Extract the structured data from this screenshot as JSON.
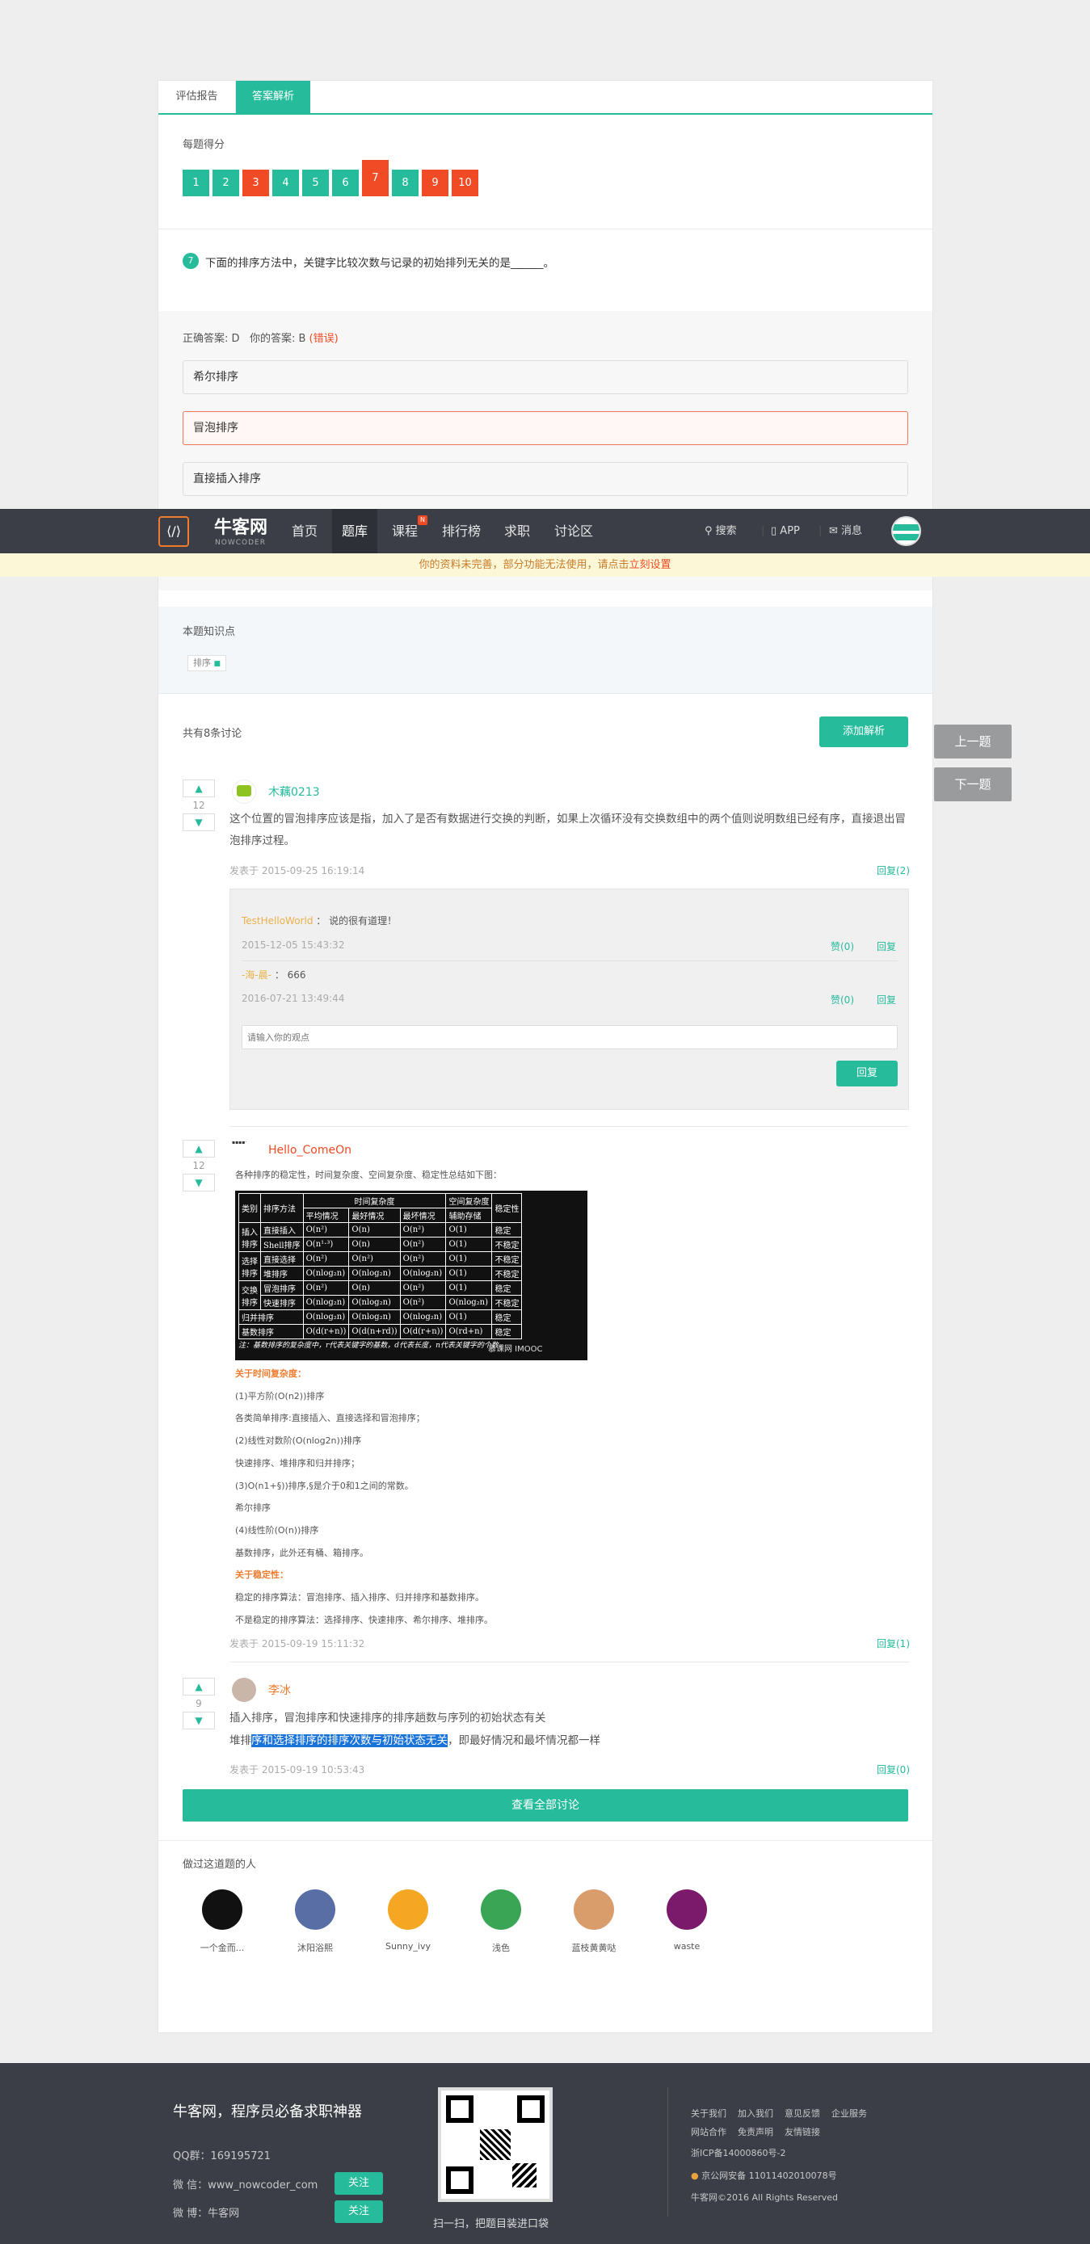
{
  "tabs": [
    "评估报告",
    "答案解析"
  ],
  "score_label": "每题得分",
  "questions": [
    {
      "n": "1",
      "status": "correct"
    },
    {
      "n": "2",
      "status": "correct"
    },
    {
      "n": "3",
      "status": "wrong"
    },
    {
      "n": "4",
      "status": "correct"
    },
    {
      "n": "5",
      "status": "correct"
    },
    {
      "n": "6",
      "status": "correct"
    },
    {
      "n": "7",
      "status": "wrong"
    },
    {
      "n": "8",
      "status": "correct"
    },
    {
      "n": "9",
      "status": "wrong"
    },
    {
      "n": "10",
      "status": "wrong"
    }
  ],
  "question": {
    "num": "7",
    "text": "下面的排序方法中，关键字比较次数与记录的初始排列无关的是______。"
  },
  "answer": {
    "correct_label": "正确答案: D",
    "yours_label": "你的答案: B",
    "verdict": "(错误)"
  },
  "options": [
    "希尔排序",
    "冒泡排序",
    "直接插入排序"
  ],
  "nav": {
    "logo": "牛客网",
    "logo_sub": "NOWCODER",
    "items": [
      "首页",
      "题库",
      "课程",
      "排行榜",
      "求职",
      "讨论区"
    ],
    "badge": "N",
    "search": "搜索",
    "app": "APP",
    "messages": "消息"
  },
  "notice": {
    "text": "你的资料未完善，部分功能无法使用，请点击",
    "link": "立刻设置"
  },
  "knowledge": {
    "title": "本题知识点",
    "tag": "排序"
  },
  "discussion": {
    "count": "共有8条讨论",
    "add_btn": "添加解析"
  },
  "side": {
    "prev": "上一题",
    "next": "下一题"
  },
  "posts": [
    {
      "votes": "12",
      "user": "木藕0213",
      "text": "这个位置的冒泡排序应该是指，加入了是否有数据进行交换的判断，如果上次循环没有交换数组中的两个值则说明数组已经有序，直接退出冒泡排序过程。",
      "time": "发表于 2015-09-25 16:19:14",
      "reply": "回复(2)",
      "comments": [
        {
          "user": "TestHelloWorld",
          "text": "：  说的很有道理！",
          "time": "2015-12-05 15:43:32",
          "like": "赞(0)",
          "reply": "回复"
        },
        {
          "user": "-海-晨-",
          "text": "：  666",
          "time": "2016-07-21 13:49:44",
          "like": "赞(0)",
          "reply": "回复"
        }
      ],
      "input_placeholder": "请输入你的观点",
      "reply_btn": "回复"
    },
    {
      "votes": "12",
      "user": "Hello_ComeOn",
      "intro": "各种排序的稳定性，时间复杂度、空间复杂度、稳定性总结如下图：",
      "lines": [
        {
          "text": "关于时间复杂度：",
          "hl": true
        },
        {
          "text": "(1)平方阶(O(n2))排序",
          "hl": false
        },
        {
          "text": "各类简单排序:直接插入、直接选择和冒泡排序；",
          "hl": false
        },
        {
          "text": "(2)线性对数阶(O(nlog2n))排序",
          "hl": false
        },
        {
          "text": "快速排序、堆排序和归并排序；",
          "hl": false
        },
        {
          "text": "(3)O(n1+§))排序,§是介于0和1之间的常数。",
          "hl": false
        },
        {
          "text": "希尔排序",
          "hl": false
        },
        {
          "text": "(4)线性阶(O(n))排序",
          "hl": false
        },
        {
          "text": "基数排序，此外还有桶、箱排序。",
          "hl": false
        },
        {
          "text": "关于稳定性：",
          "hl": true
        },
        {
          "text": "稳定的排序算法：冒泡排序、插入排序、归并排序和基数排序。",
          "hl": false
        },
        {
          "text": "不是稳定的排序算法：选择排序、快速排序、希尔排序、堆排序。",
          "hl": false
        }
      ],
      "time": "发表于 2015-09-19 15:11:32",
      "reply": "回复(1)"
    },
    {
      "votes": "9",
      "user": "李冰",
      "line1": "插入排序，冒泡排序和快速排序的排序趟数与序列的初始状态有关",
      "line2_pre": "堆排",
      "line2_sel": "序和选择排序的排序次数与初始状态无关",
      "line2_post": "，即最好情况和最坏情况都一样",
      "time": "发表于 2015-09-19 10:53:43",
      "reply": "回复(0)"
    }
  ],
  "sort_table": {
    "headers": {
      "cat": "类别",
      "method": "排序方法",
      "time": "时间复杂度",
      "avg": "平均情况",
      "best": "最好情况",
      "worst": "最坏情况",
      "space": "空间复杂度",
      "aux": "辅助存储",
      "stable": "稳定性"
    },
    "rows": [
      {
        "cat": "插入\n排序",
        "m": "直接插入",
        "avg": "O(n²)",
        "best": "O(n)",
        "worst": "O(n²)",
        "aux": "O(1)",
        "st": "稳定"
      },
      {
        "cat": "",
        "m": "Shell排序",
        "avg": "O(n¹·³)",
        "best": "O(n)",
        "worst": "O(n²)",
        "aux": "O(1)",
        "st": "不稳定"
      },
      {
        "cat": "选择\n排序",
        "m": "直接选择",
        "avg": "O(n²)",
        "best": "O(n²)",
        "worst": "O(n²)",
        "aux": "O(1)",
        "st": "不稳定"
      },
      {
        "cat": "",
        "m": "堆排序",
        "avg": "O(nlog₂n)",
        "best": "O(nlog₂n)",
        "worst": "O(nlog₂n)",
        "aux": "O(1)",
        "st": "不稳定"
      },
      {
        "cat": "交换\n排序",
        "m": "冒泡排序",
        "avg": "O(n²)",
        "best": "O(n)",
        "worst": "O(n²)",
        "aux": "O(1)",
        "st": "稳定"
      },
      {
        "cat": "",
        "m": "快速排序",
        "avg": "O(nlog₂n)",
        "best": "O(nlog₂n)",
        "worst": "O(n²)",
        "aux": "O(nlog₂n)",
        "st": "不稳定"
      },
      {
        "cat": "归并排序",
        "m": "",
        "avg": "O(nlog₂n)",
        "best": "O(nlog₂n)",
        "worst": "O(nlog₂n)",
        "aux": "O(1)",
        "st": "稳定"
      },
      {
        "cat": "基数排序",
        "m": "",
        "avg": "O(d(r+n))",
        "best": "O(d(n+rd))",
        "worst": "O(d(r+n))",
        "aux": "O(rd+n)",
        "st": "稳定"
      }
    ],
    "note": "注：基数排序的复杂度中，r代表关键字的基数，d代表长度，n代表关键字的个数。",
    "watermark": "慕课网 IMOOC"
  },
  "view_all": "查看全部讨论",
  "people": {
    "title": "做过这道题的人",
    "list": [
      {
        "name": "一个金而...",
        "color": "#111111"
      },
      {
        "name": "沐阳浴熙",
        "color": "#5a6ea6"
      },
      {
        "name": "Sunny_ivy",
        "color": "#f5a623"
      },
      {
        "name": "浅色",
        "color": "#3aa655"
      },
      {
        "name": "蓝枝黄黄哒",
        "color": "#d99c6b"
      },
      {
        "name": "waste",
        "color": "#7b1a6b"
      }
    ]
  },
  "footer": {
    "slogan": "牛客网，程序员必备求职神器",
    "qq": "QQ群：169195721",
    "wechat": "微 信：www_nowcoder_com",
    "weibo": "微 博：牛客网",
    "follow": "关注",
    "qr_caption": "扫一扫，把题目装进口袋",
    "links_row1": [
      "关于我们",
      "加入我们",
      "意见反馈",
      "企业服务"
    ],
    "links_row2": [
      "网站合作",
      "免责声明",
      "友情链接"
    ],
    "icp": "浙ICP备14000860号-2",
    "police": "京公网安备 11011402010078号",
    "copyright": "牛客网©2016 All Rights Reserved"
  },
  "colors": {
    "accent": "#25bb9b",
    "wrong": "#f04b24",
    "nav": "#3b3e47"
  }
}
